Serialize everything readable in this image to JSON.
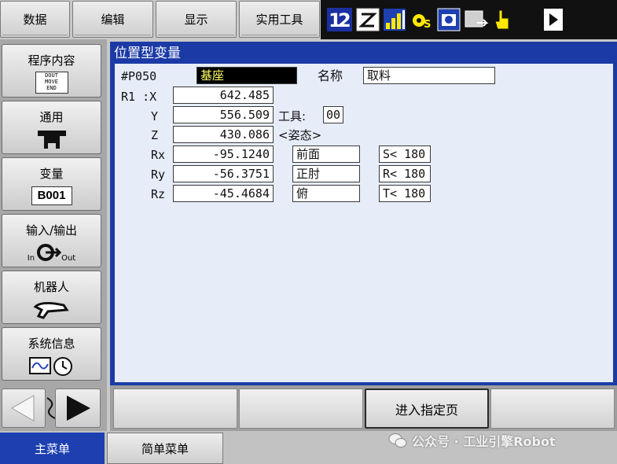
{
  "top_menu": [
    "数据",
    "编辑",
    "显示",
    "实用工具"
  ],
  "status_icons": [
    "sequence-12-icon",
    "edit-mode-icon",
    "signal-bars-icon",
    "gear-icon",
    "mode-icon",
    "window-icon",
    "hand-icon",
    "play-icon"
  ],
  "sidebar": {
    "program": {
      "label": "程序内容",
      "art_lines": [
        "DOUT",
        "MOVE",
        "END"
      ]
    },
    "general": {
      "label": "通用"
    },
    "variable": {
      "label": "变量",
      "art": "B001"
    },
    "io": {
      "label": "输入/输出",
      "art_in": "In",
      "art_out": "Out"
    },
    "robot": {
      "label": "机器人"
    },
    "system": {
      "label": "系统信息"
    }
  },
  "panel": {
    "title": "位置型变量",
    "var_id": "#P050",
    "coord_frame": "基座",
    "name_label": "名称",
    "name_value": "取料",
    "robot_axis_label": "R1 :X",
    "y_label": "Y",
    "z_label": "Z",
    "rx_label": "Rx",
    "ry_label": "Ry",
    "rz_label": "Rz",
    "x": "642.485",
    "y": "556.509",
    "z": "430.086",
    "rx": "-95.1240",
    "ry": "-56.3751",
    "rz": "-45.4684",
    "tool_label": "工具:",
    "tool_value": "00",
    "posture_label": "<姿态>",
    "posture": [
      "前面",
      "正肘",
      "俯"
    ],
    "limits": [
      "S< 180",
      "R< 180",
      "T< 180"
    ]
  },
  "function_keys": [
    "",
    "",
    "进入指定页",
    ""
  ],
  "bottom_tabs": {
    "main": "主菜单",
    "simple": "简单菜单"
  },
  "watermark": "公众号 · 工业引擎Robot",
  "colors": {
    "panel_blue": "#1b3aa6",
    "content_bg": "#e6ecf8",
    "main_tab": "#1d3fb0",
    "highlight": "#000000",
    "highlight_text": "#ffff66"
  }
}
